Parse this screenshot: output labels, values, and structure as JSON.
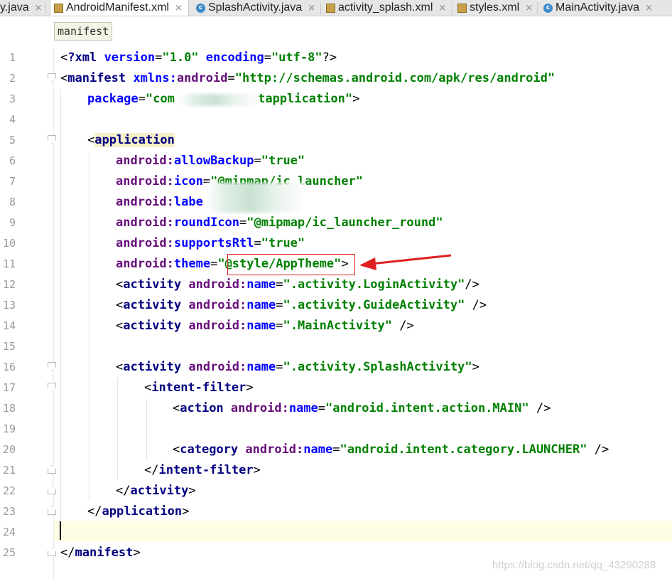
{
  "tabs": [
    {
      "label": "y.java",
      "icon": "class-icon",
      "active": false
    },
    {
      "label": "AndroidManifest.xml",
      "icon": "manifest-file-icon",
      "active": true
    },
    {
      "label": "SplashActivity.java",
      "icon": "class-icon",
      "active": false
    },
    {
      "label": "activity_splash.xml",
      "icon": "xml-file-icon",
      "active": false
    },
    {
      "label": "styles.xml",
      "icon": "xml-file-icon",
      "active": false
    },
    {
      "label": "MainActivity.java",
      "icon": "class-icon",
      "active": false
    }
  ],
  "close_glyph": "×",
  "breadcrumb": "manifest",
  "line_numbers": [
    "1",
    "2",
    "3",
    "4",
    "5",
    "6",
    "7",
    "8",
    "9",
    "10",
    "11",
    "12",
    "13",
    "14",
    "15",
    "16",
    "17",
    "18",
    "19",
    "20",
    "21",
    "22",
    "23",
    "24",
    "25"
  ],
  "code": {
    "l1": {
      "a": "<",
      "b": "?xml",
      "c": " ",
      "d": "version",
      "e": "=",
      "f": "\"1.0\"",
      "g": " ",
      "h": "encoding",
      "i": "=",
      "j": "\"utf-8\"",
      "k": "?>"
    },
    "l2": {
      "a": "<",
      "b": "manifest",
      "c": " ",
      "d": "xmlns:",
      "e": "android",
      "f": "=",
      "g": "\"http://schemas.android.com/apk/res/android\""
    },
    "l3": {
      "a": "package",
      "b": "=",
      "c": "\"com",
      "d": "stapplication\"",
      "e": ">"
    },
    "l5": {
      "a": "<",
      "b": "application"
    },
    "l6": {
      "a": "android:",
      "b": "allowBackup",
      "c": "=",
      "d": "\"true\""
    },
    "l7": {
      "a": "android:",
      "b": "icon",
      "c": "=",
      "d": "\"@mipmap/ic_launcher\""
    },
    "l8": {
      "a": "android:",
      "b": "labe"
    },
    "l9": {
      "a": "android:",
      "b": "roundIcon",
      "c": "=",
      "d": "\"@mipmap/ic_launcher_round\""
    },
    "l10": {
      "a": "android:",
      "b": "supportsRtl",
      "c": "=",
      "d": "\"true\""
    },
    "l11": {
      "a": "android:",
      "b": "theme",
      "c": "=",
      "d": "\"@style/AppTheme\"",
      "e": ">"
    },
    "l12": {
      "a": "<",
      "b": "activity",
      "c": " ",
      "d": "android:",
      "e": "name",
      "f": "=",
      "g": "\".activity.LoginActivity\"",
      "h": "/>"
    },
    "l13": {
      "a": "<",
      "b": "activity",
      "c": " ",
      "d": "android:",
      "e": "name",
      "f": "=",
      "g": "\".activity.GuideActivity\"",
      "h": " />"
    },
    "l14": {
      "a": "<",
      "b": "activity",
      "c": " ",
      "d": "android:",
      "e": "name",
      "f": "=",
      "g": "\".MainActivity\"",
      "h": " />"
    },
    "l16": {
      "a": "<",
      "b": "activity",
      "c": " ",
      "d": "android:",
      "e": "name",
      "f": "=",
      "g": "\".activity.SplashActivity\"",
      "h": ">"
    },
    "l17": {
      "a": "<",
      "b": "intent-filter",
      "c": ">"
    },
    "l18": {
      "a": "<",
      "b": "action",
      "c": " ",
      "d": "android:",
      "e": "name",
      "f": "=",
      "g": "\"android.intent.action.MAIN\"",
      "h": " />"
    },
    "l20": {
      "a": "<",
      "b": "category",
      "c": " ",
      "d": "android:",
      "e": "name",
      "f": "=",
      "g": "\"android.intent.category.LAUNCHER\"",
      "h": " />"
    },
    "l21": {
      "a": "</",
      "b": "intent-filter",
      "c": ">"
    },
    "l22": {
      "a": "</",
      "b": "activity",
      "c": ">"
    },
    "l23": {
      "a": "</",
      "b": "application",
      "c": ">"
    },
    "l25": {
      "a": "</",
      "b": "manifest",
      "c": ">"
    }
  },
  "watermark": "https://blog.csdn.net/qq_43290288",
  "colors": {
    "tag": "#000080",
    "attribute": "#0000ff",
    "namespace": "#660e7a",
    "value": "#008000",
    "current_line": "#fffce4",
    "annotation": "#e02020"
  }
}
